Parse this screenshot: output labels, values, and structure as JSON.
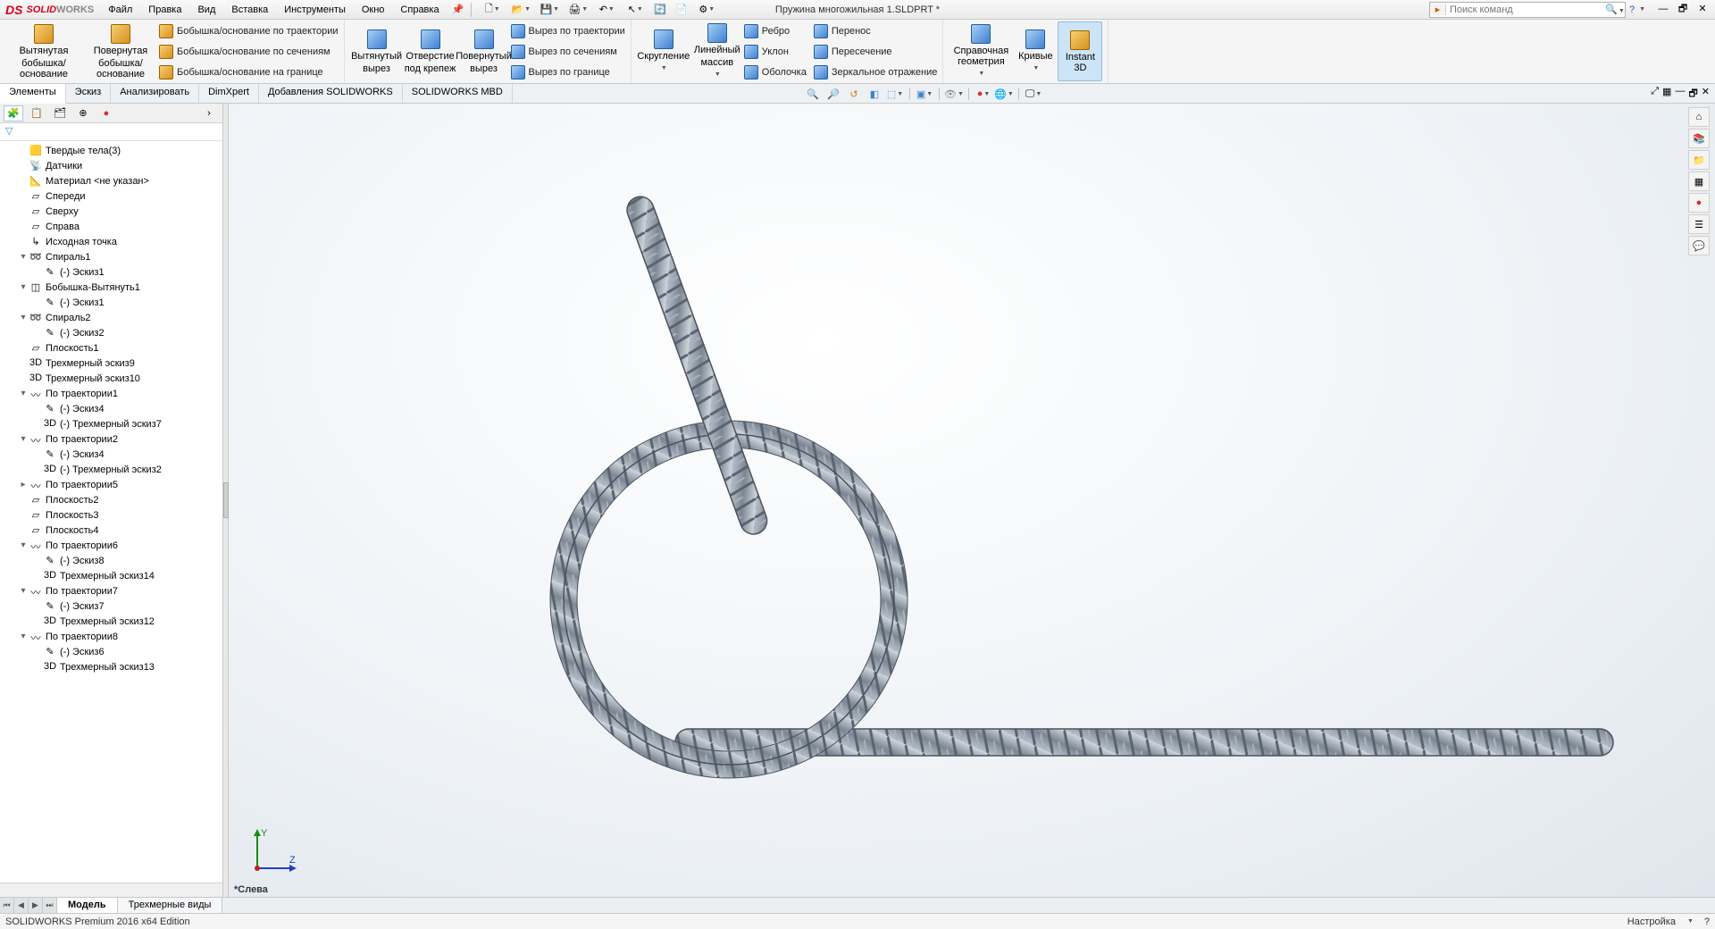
{
  "app": {
    "brand_ds": "DS",
    "brand_solid": "SOLID",
    "brand_works": "WORKS",
    "doc_title": "Пружина многожильная 1.SLDPRT *"
  },
  "menu": [
    "Файл",
    "Правка",
    "Вид",
    "Вставка",
    "Инструменты",
    "Окно",
    "Справка"
  ],
  "search": {
    "placeholder": "Поиск команд"
  },
  "help_btn": "?",
  "ribbon": {
    "big": [
      {
        "l1": "Вытянутая",
        "l2": "бобышка/основание"
      },
      {
        "l1": "Повернутая",
        "l2": "бобышка/основание"
      }
    ],
    "boss_rows": [
      "Бобышка/основание по траектории",
      "Бобышка/основание по сечениям",
      "Бобышка/основание на границе"
    ],
    "cut_big": [
      {
        "l1": "Вытянутый",
        "l2": "вырез"
      },
      {
        "l1": "Отверстие",
        "l2": "под крепеж"
      },
      {
        "l1": "Повернутый",
        "l2": "вырез"
      }
    ],
    "cut_rows": [
      "Вырез по траектории",
      "Вырез по сечениям",
      "Вырез по границе"
    ],
    "feat_big": [
      {
        "l1": "Скругление",
        "l2": ""
      },
      {
        "l1": "Линейный",
        "l2": "массив"
      }
    ],
    "feat_rows": [
      "Ребро",
      "Уклон",
      "Оболочка"
    ],
    "geom_rows": [
      "Перенос",
      "Пересечение",
      "Зеркальное отражение"
    ],
    "right_big": [
      "Справочная геометрия",
      "Кривые",
      "Instant 3D"
    ]
  },
  "ribbon_tabs": [
    "Элементы",
    "Эскиз",
    "Анализировать",
    "DimXpert",
    "Добавления SOLIDWORKS",
    "SOLIDWORKS MBD"
  ],
  "active_ribbon_tab": 0,
  "tree": [
    {
      "lvl": 1,
      "tw": "",
      "icon": "cube",
      "label": "Твердые тела(3)"
    },
    {
      "lvl": 1,
      "tw": "",
      "icon": "sensor",
      "label": "Датчики"
    },
    {
      "lvl": 1,
      "tw": "",
      "icon": "mat",
      "label": "Материал <не указан>"
    },
    {
      "lvl": 1,
      "tw": "",
      "icon": "plane",
      "label": "Спереди"
    },
    {
      "lvl": 1,
      "tw": "",
      "icon": "plane",
      "label": "Сверху"
    },
    {
      "lvl": 1,
      "tw": "",
      "icon": "plane",
      "label": "Справа"
    },
    {
      "lvl": 1,
      "tw": "",
      "icon": "origin",
      "label": "Исходная точка"
    },
    {
      "lvl": 1,
      "tw": "▾",
      "icon": "helix",
      "label": "Спираль1"
    },
    {
      "lvl": 2,
      "tw": "",
      "icon": "sk",
      "label": "(-) Эскиз1"
    },
    {
      "lvl": 1,
      "tw": "▾",
      "icon": "extrude",
      "label": "Бобышка-Вытянуть1"
    },
    {
      "lvl": 2,
      "tw": "",
      "icon": "sk",
      "label": "(-) Эскиз1"
    },
    {
      "lvl": 1,
      "tw": "▾",
      "icon": "helix",
      "label": "Спираль2"
    },
    {
      "lvl": 2,
      "tw": "",
      "icon": "sk",
      "label": "(-) Эскиз2"
    },
    {
      "lvl": 1,
      "tw": "",
      "icon": "plane",
      "label": "Плоскость1"
    },
    {
      "lvl": 1,
      "tw": "",
      "icon": "3d",
      "label": "Трехмерный эскиз9"
    },
    {
      "lvl": 1,
      "tw": "",
      "icon": "3d",
      "label": "Трехмерный эскиз10"
    },
    {
      "lvl": 1,
      "tw": "▾",
      "icon": "sweep",
      "label": "По траектории1"
    },
    {
      "lvl": 2,
      "tw": "",
      "icon": "sk",
      "label": "(-) Эскиз4"
    },
    {
      "lvl": 2,
      "tw": "",
      "icon": "3d",
      "label": "(-) Трехмерный эскиз7"
    },
    {
      "lvl": 1,
      "tw": "▾",
      "icon": "sweep",
      "label": "По траектории2"
    },
    {
      "lvl": 2,
      "tw": "",
      "icon": "sk",
      "label": "(-) Эскиз4"
    },
    {
      "lvl": 2,
      "tw": "",
      "icon": "3d",
      "label": "(-) Трехмерный эскиз2"
    },
    {
      "lvl": 1,
      "tw": "▸",
      "icon": "sweep",
      "label": "По траектории5"
    },
    {
      "lvl": 1,
      "tw": "",
      "icon": "plane",
      "label": "Плоскость2"
    },
    {
      "lvl": 1,
      "tw": "",
      "icon": "plane",
      "label": "Плоскость3"
    },
    {
      "lvl": 1,
      "tw": "",
      "icon": "plane",
      "label": "Плоскость4"
    },
    {
      "lvl": 1,
      "tw": "▾",
      "icon": "sweep",
      "label": "По траектории6"
    },
    {
      "lvl": 2,
      "tw": "",
      "icon": "sk",
      "label": "(-) Эскиз8"
    },
    {
      "lvl": 2,
      "tw": "",
      "icon": "3d",
      "label": "Трехмерный эскиз14"
    },
    {
      "lvl": 1,
      "tw": "▾",
      "icon": "sweep",
      "label": "По траектории7"
    },
    {
      "lvl": 2,
      "tw": "",
      "icon": "sk",
      "label": "(-) Эскиз7"
    },
    {
      "lvl": 2,
      "tw": "",
      "icon": "3d",
      "label": "Трехмерный эскиз12"
    },
    {
      "lvl": 1,
      "tw": "▾",
      "icon": "sweep",
      "label": "По траектории8"
    },
    {
      "lvl": 2,
      "tw": "",
      "icon": "sk",
      "label": "(-) Эскиз6"
    },
    {
      "lvl": 2,
      "tw": "",
      "icon": "3d",
      "label": "Трехмерный эскиз13"
    }
  ],
  "view_label": "*Слева",
  "triad": {
    "y": "Y",
    "z": "Z"
  },
  "bottom_tabs": [
    "Модель",
    "Трехмерные виды"
  ],
  "active_bottom_tab": 0,
  "status": {
    "left": "SOLIDWORKS Premium 2016 x64 Edition",
    "right": "Настройка"
  }
}
